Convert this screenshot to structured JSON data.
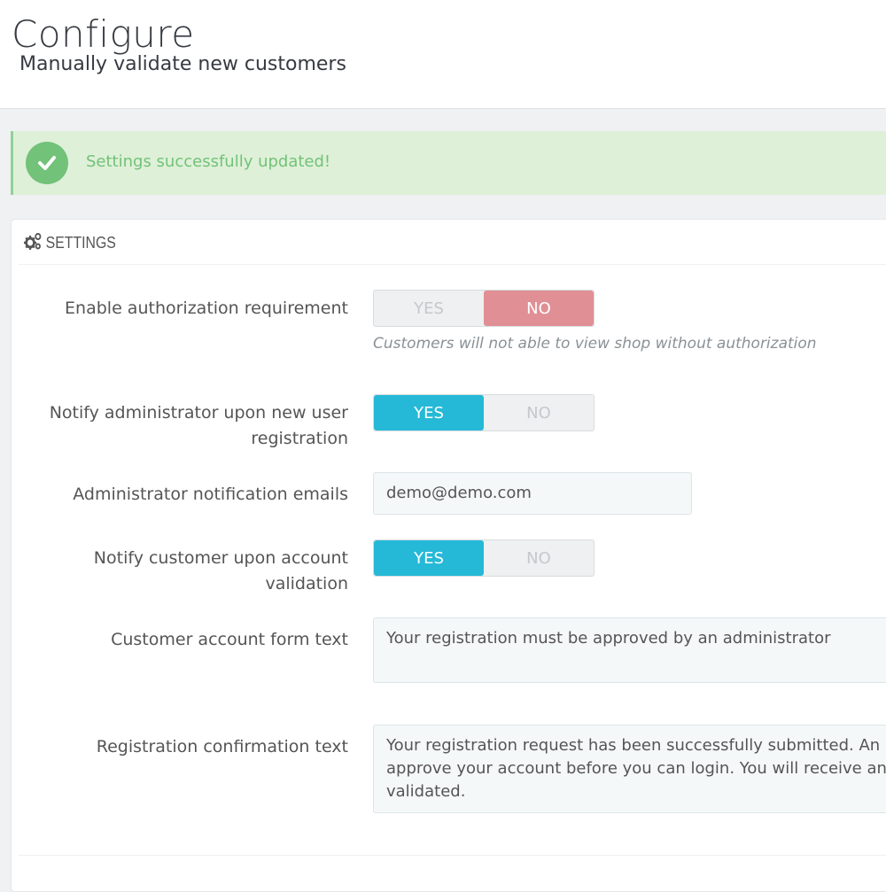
{
  "header": {
    "title": "Configure",
    "subtitle": "Manually validate new customers"
  },
  "alert": {
    "message": "Settings successfully updated!",
    "icon": "check-circle-icon",
    "color": "#72c279"
  },
  "panel": {
    "heading": "SETTINGS",
    "heading_icon": "gears-icon"
  },
  "form": {
    "auth_requirement": {
      "label": "Enable authorization requirement",
      "yes": "YES",
      "no": "NO",
      "selected": "NO",
      "help": "Customers will not able to view shop without authorization"
    },
    "notify_admin": {
      "label_line1": "Notify administrator upon new user",
      "label_line2": "registration",
      "yes": "YES",
      "no": "NO",
      "selected": "YES"
    },
    "admin_emails": {
      "label": "Administrator notification emails",
      "value": "demo@demo.com"
    },
    "notify_customer": {
      "label_line1": "Notify customer upon account",
      "label_line2": "validation",
      "yes": "YES",
      "no": "NO",
      "selected": "YES"
    },
    "account_form_text": {
      "label": "Customer account form text",
      "value": "Your registration must be approved by an administrator"
    },
    "confirmation_text": {
      "label": "Registration confirmation text",
      "line1": "Your registration request has been successfully submitted. An ad",
      "line2": "approve your account before you can login. You will receive an er",
      "line3": "validated."
    }
  },
  "colors": {
    "accent": "#25b9d7",
    "danger_switch": "#e08f95",
    "success_bg": "#dff0d8"
  }
}
